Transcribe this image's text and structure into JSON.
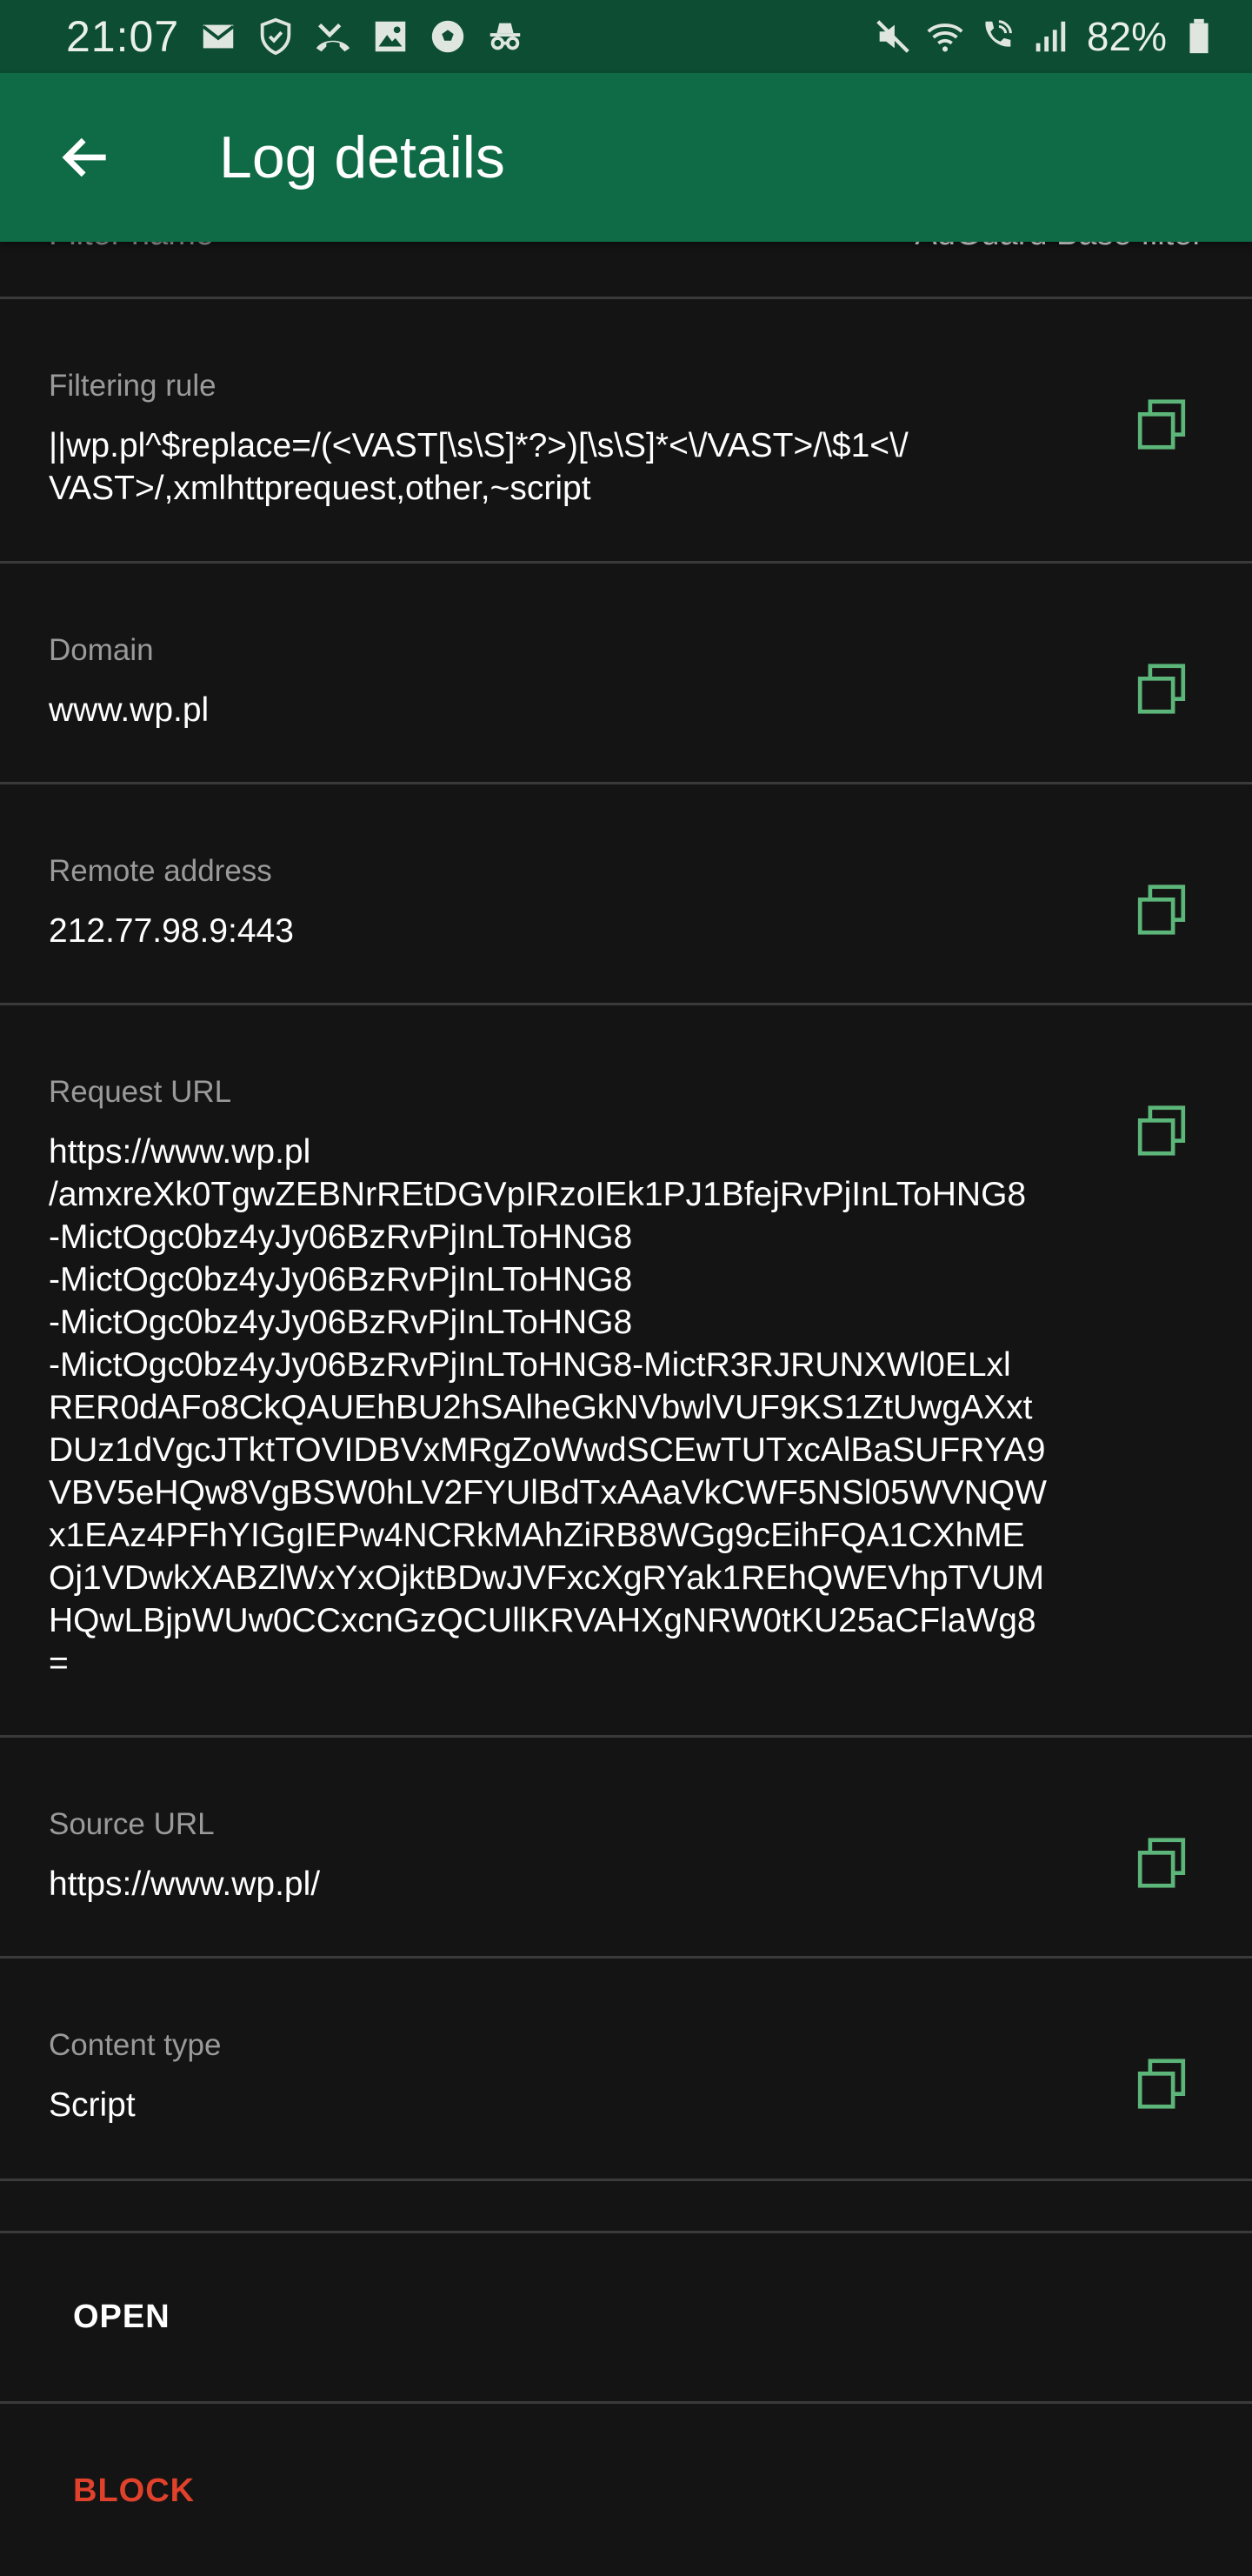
{
  "status_bar": {
    "time": "21:07",
    "battery": "82%",
    "left_icons": [
      "mail-icon",
      "shield-icon",
      "missed-call-icon",
      "image-icon",
      "soccer-ball-icon",
      "incognito-icon"
    ],
    "right_icons": [
      "mute-icon",
      "wifi-icon",
      "wifi-call-icon",
      "signal-icon",
      "battery-icon"
    ]
  },
  "app_bar": {
    "title": "Log details",
    "back_icon": "arrow-left-icon"
  },
  "partial_row": {
    "label": "Filter name",
    "value": "AdGuard Base filter"
  },
  "details": [
    {
      "label": "Filtering rule",
      "value": "||wp.pl^$replace=/(<VAST[\\s\\S]*?>)[\\s\\S]*<\\/VAST>/\\$1<\\/\nVAST>/,xmlhttprequest,other,~script"
    },
    {
      "label": "Domain",
      "value": "www.wp.pl"
    },
    {
      "label": "Remote address",
      "value": "212.77.98.9:443"
    },
    {
      "label": "Request URL",
      "value": "https://www.wp.pl\n/amxreXk0TgwZEBNrREtDGVpIRzoIEk1PJ1BfejRvPjInLToHNG8\n-MictOgc0bz4yJy06BzRvPjInLToHNG8\n-MictOgc0bz4yJy06BzRvPjInLToHNG8\n-MictOgc0bz4yJy06BzRvPjInLToHNG8\n-MictOgc0bz4yJy06BzRvPjInLToHNG8-MictR3RJRUNXWl0ELxl\nRER0dAFo8CkQAUEhBU2hSAlheGkNVbwlVUF9KS1ZtUwgAXxt\nDUz1dVgcJTktTOVIDBVxMRgZoWwdSCEwTUTxcAlBaSUFRYA9\nVBV5eHQw8VgBSW0hLV2FYUlBdTxAAaVkCWF5NSl05WVNQW\nx1EAz4PFhYIGgIEPw4NCRkMAhZiRB8WGg9cEihFQA1CXhME\nOj1VDwkXABZlWxYxOjktBDwJVFxcXgRYak1REhQWEVhpTVUM\nHQwLBjpWUw0CCxcnGzQCUllKRVAHXgNRW0tKU25aCFlaWg8\n="
    },
    {
      "label": "Source URL",
      "value": "https://www.wp.pl/"
    },
    {
      "label": "Content type",
      "value": "Script"
    }
  ],
  "actions": {
    "open_label": "OPEN",
    "block_label": "BLOCK"
  },
  "colors": {
    "status_bar": "#0c4d33",
    "app_bar": "#0e6b46",
    "background": "#141414",
    "copy_icon": "#5cb579",
    "block": "#e0412b",
    "open": "#ffffff"
  }
}
